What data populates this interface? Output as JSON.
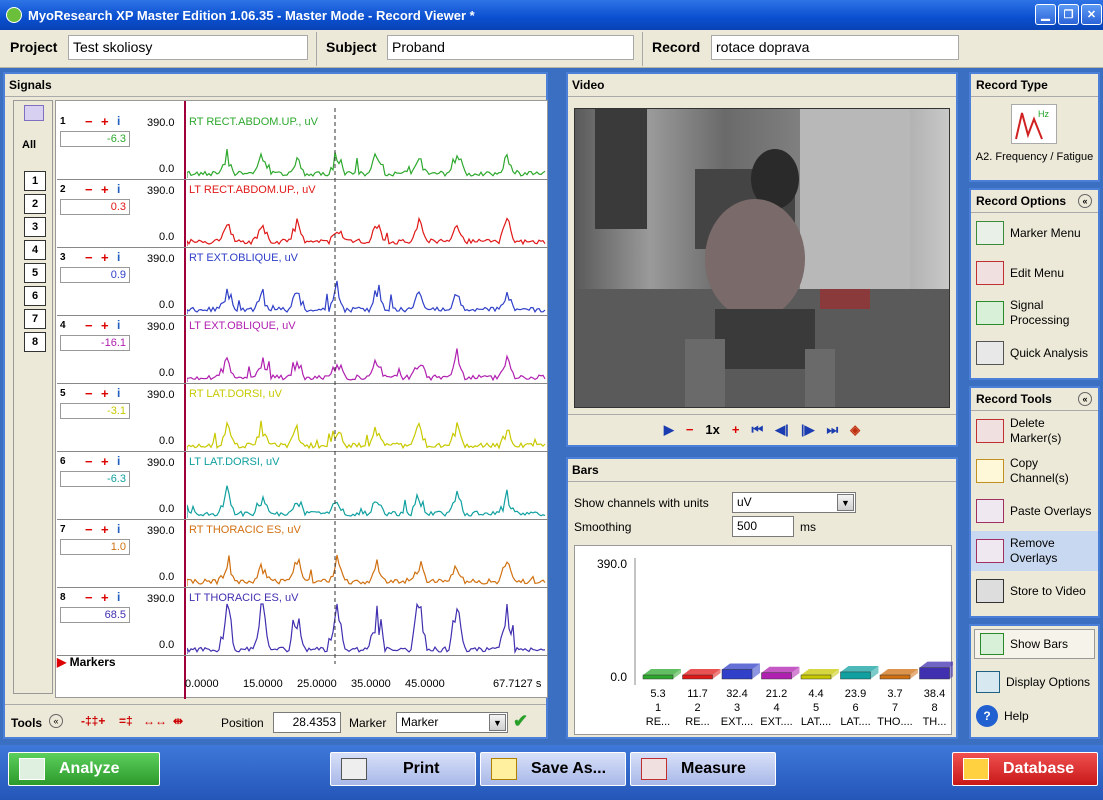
{
  "window": {
    "title": "MyoResearch XP Master Edition 1.06.35 - Master Mode - Record Viewer *"
  },
  "topbar": {
    "project_label": "Project",
    "project_value": "Test skoliosy",
    "subject_label": "Subject",
    "subject_value": "Proband",
    "record_label": "Record",
    "record_value": "rotace doprava"
  },
  "signals": {
    "title": "Signals",
    "all_label": "All",
    "channel_buttons": [
      "1",
      "2",
      "3",
      "4",
      "5",
      "6",
      "7",
      "8"
    ],
    "max_label": "390.0",
    "min_label": "0.0",
    "channels": [
      {
        "num": "1",
        "value": "-6.3",
        "label": "RT RECT.ABDOM.UP., uV",
        "color": "#2da82d"
      },
      {
        "num": "2",
        "value": "0.3",
        "label": "LT RECT.ABDOM.UP., uV",
        "color": "#e01818"
      },
      {
        "num": "3",
        "value": "0.9",
        "label": "RT EXT.OBLIQUE, uV",
        "color": "#3040c8"
      },
      {
        "num": "4",
        "value": "-16.1",
        "label": "LT EXT.OBLIQUE, uV",
        "color": "#b020b0"
      },
      {
        "num": "5",
        "value": "-3.1",
        "label": "RT LAT.DORSI, uV",
        "color": "#c8c800"
      },
      {
        "num": "6",
        "value": "-6.3",
        "label": "LT LAT.DORSI, uV",
        "color": "#10a0a0"
      },
      {
        "num": "7",
        "value": "1.0",
        "label": "RT THORACIC ES, uV",
        "color": "#d07010"
      },
      {
        "num": "8",
        "value": "68.5",
        "label": "LT THORACIC ES, uV",
        "color": "#4030b0"
      }
    ],
    "markers_label": "Markers",
    "time_ticks": [
      "0.0000",
      "15.0000",
      "25.0000",
      "35.0000",
      "45.0000",
      "67.7127 s"
    ],
    "tools_label": "Tools",
    "position_label": "Position",
    "position_value": "28.4353",
    "marker_label": "Marker",
    "marker_value": "Marker"
  },
  "video": {
    "title": "Video",
    "speed": "1x"
  },
  "bars": {
    "title": "Bars",
    "show_label": "Show channels with units",
    "units_value": "uV",
    "smoothing_label": "Smoothing",
    "smoothing_value": "500",
    "smoothing_unit": "ms",
    "ymax": "390.0",
    "ymin": "0.0"
  },
  "chart_data": {
    "type": "bar",
    "categories": [
      "1 RE...",
      "2 RE...",
      "3 EXT....",
      "4 EXT....",
      "5 LAT....",
      "6 LAT....",
      "7 THO....",
      "8 TH..."
    ],
    "values": [
      5.3,
      11.7,
      32.4,
      21.2,
      4.4,
      23.9,
      3.7,
      38.4
    ],
    "value_labels": [
      "5.3",
      "11.7",
      "32.4",
      "21.2",
      "4.4",
      "23.9",
      "3.7",
      "38.4"
    ],
    "numbers": [
      "1",
      "2",
      "3",
      "4",
      "5",
      "6",
      "7",
      "8"
    ],
    "short_names": [
      "RE...",
      "RE...",
      "EXT....",
      "EXT....",
      "LAT....",
      "LAT....",
      "THO....",
      "TH..."
    ],
    "colors": [
      "#2da82d",
      "#e01818",
      "#3040c8",
      "#b020b0",
      "#c8c800",
      "#10a0a0",
      "#d07010",
      "#4030b0"
    ],
    "ylim": [
      0,
      390
    ],
    "ylabel": "",
    "xlabel": ""
  },
  "right": {
    "record_type_title": "Record Type",
    "record_type_value": "A2. Frequency / Fatigue",
    "record_options_title": "Record Options",
    "record_options": [
      "Marker Menu",
      "Edit Menu",
      "Signal Processing",
      "Quick Analysis"
    ],
    "record_tools_title": "Record Tools",
    "record_tools": [
      "Delete Marker(s)",
      "Copy Channel(s)",
      "Paste Overlays",
      "Remove Overlays",
      "Store to Video"
    ],
    "show_bars": "Show Bars",
    "display_options": "Display Options",
    "help": "Help"
  },
  "bottom": {
    "analyze": "Analyze",
    "print": "Print",
    "save_as": "Save As...",
    "measure": "Measure",
    "database": "Database"
  }
}
